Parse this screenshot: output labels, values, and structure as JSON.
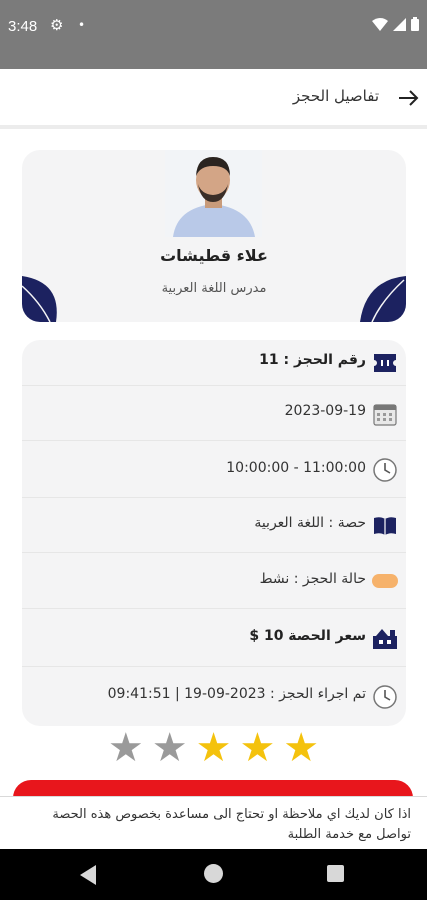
{
  "status_bar": {
    "time": "3:48"
  },
  "header": {
    "title": "تفاصيل الحجز"
  },
  "teacher": {
    "name": "علاء قطيشات",
    "role": "مدرس اللغة العربية"
  },
  "details": {
    "booking_number": "رقم الحجز :  11",
    "date": "2023-09-19",
    "time_range": "11:00:00 - 10:00:00",
    "lesson": "حصة : اللغة العربية",
    "status": "حالة الحجز : نشط",
    "price": "سعر الحصة 10 $",
    "booked_at": "تم اجراء الحجز :  2023-09-19 | 09:41:51"
  },
  "rating": {
    "value": 3,
    "max": 5
  },
  "help": {
    "text": "اذا كان لديك اي ملاحظة او تحتاج الى مساعدة بخصوص هذه الحصة تواصل مع خدمة الطلبة"
  },
  "colors": {
    "accent_navy": "#1c2260",
    "status_orange": "#f6b26b",
    "star_gold": "#f4c20d",
    "danger_red": "#e8161c"
  }
}
